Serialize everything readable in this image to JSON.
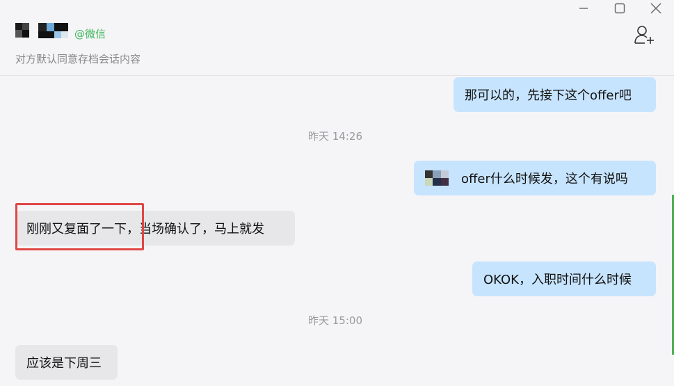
{
  "header": {
    "contact_suffix": "@微信",
    "subtitle": "对方默认同意存档会话内容"
  },
  "messages": {
    "m1": "那可以的，先接下这个offer吧",
    "ts1": "昨天 14:26",
    "m2": "offer什么时候发，这个有说吗",
    "m3": "刚刚又复面了一下，当场确认了，马上就发",
    "m4": "OKOK，入职时间什么时候",
    "ts2": "昨天 15:00",
    "m5": "应该是下周三"
  },
  "colors": {
    "self_bubble": "#c7e4ff",
    "other_bubble": "#e7e7ea",
    "highlight": "#e04646",
    "wechat_green": "#3cb558"
  },
  "icons": [
    "minimize-icon",
    "maximize-icon",
    "close-icon",
    "add-user-icon"
  ]
}
